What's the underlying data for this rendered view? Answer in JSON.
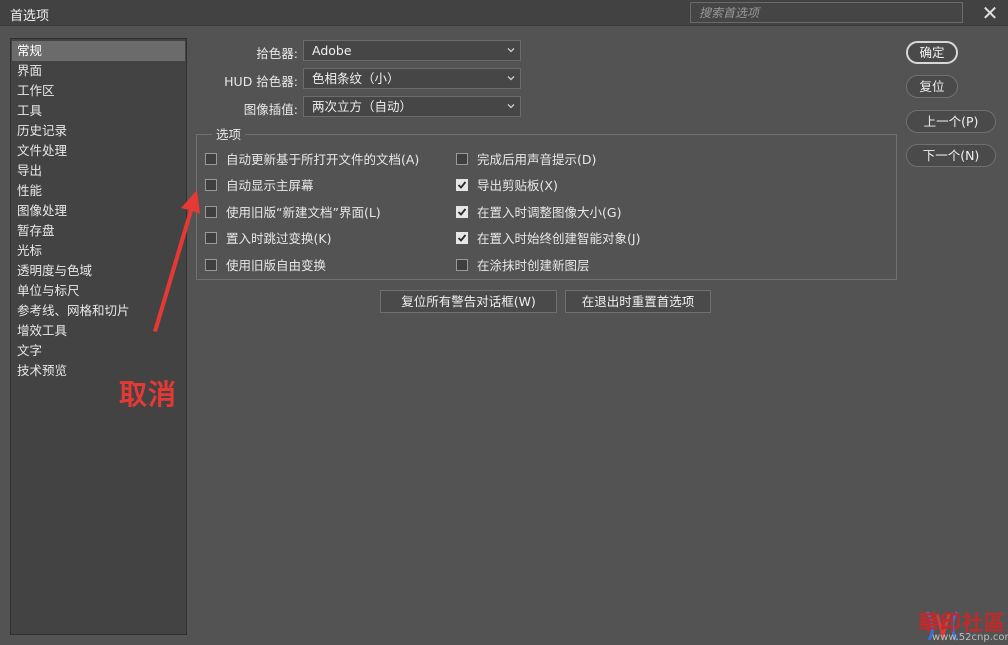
{
  "window": {
    "title": "首选项",
    "search_placeholder": "搜索首选项",
    "close_glyph": "✕"
  },
  "sidebar": {
    "items": [
      {
        "label": "常规",
        "selected": true
      },
      {
        "label": "界面"
      },
      {
        "label": "工作区"
      },
      {
        "label": "工具"
      },
      {
        "label": "历史记录"
      },
      {
        "label": "文件处理"
      },
      {
        "label": "导出"
      },
      {
        "label": "性能"
      },
      {
        "label": "图像处理"
      },
      {
        "label": "暂存盘"
      },
      {
        "label": "光标"
      },
      {
        "label": "透明度与色域"
      },
      {
        "label": "单位与标尺"
      },
      {
        "label": "参考线、网格和切片"
      },
      {
        "label": "增效工具"
      },
      {
        "label": "文字"
      },
      {
        "label": "技术预览"
      }
    ]
  },
  "fields": {
    "color_picker": {
      "label": "拾色器:",
      "value": "Adobe"
    },
    "hud_color_picker": {
      "label": "HUD 拾色器:",
      "value": "色相条纹（小）"
    },
    "image_interpolation": {
      "label": "图像插值:",
      "value": "两次立方（自动）"
    }
  },
  "options": {
    "legend": "选项",
    "left": [
      {
        "label": "自动更新基于所打开文件的文档(A)",
        "checked": false
      },
      {
        "label": "自动显示主屏幕",
        "checked": false
      },
      {
        "label": "使用旧版“新建文档”界面(L)",
        "checked": false
      },
      {
        "label": "置入时跳过变换(K)",
        "checked": false
      },
      {
        "label": "使用旧版自由变换",
        "checked": false
      }
    ],
    "right": [
      {
        "label": "完成后用声音提示(D)",
        "checked": false
      },
      {
        "label": "导出剪贴板(X)",
        "checked": true
      },
      {
        "label": "在置入时调整图像大小(G)",
        "checked": true
      },
      {
        "label": "在置入时始终创建智能对象(J)",
        "checked": true
      },
      {
        "label": "在涂抹时创建新图层",
        "checked": false
      }
    ]
  },
  "actions": {
    "reset_warnings": "复位所有警告对话框(W)",
    "reset_on_quit": "在退出时重置首选项"
  },
  "buttons": {
    "ok": "确定",
    "reset": "复位",
    "prev": "上一个(P)",
    "next": "下一个(N)"
  },
  "annotation": {
    "text": "取消",
    "color": "#e53935"
  },
  "watermark": {
    "text": "華印社區",
    "url": "www.52cnp.com"
  }
}
